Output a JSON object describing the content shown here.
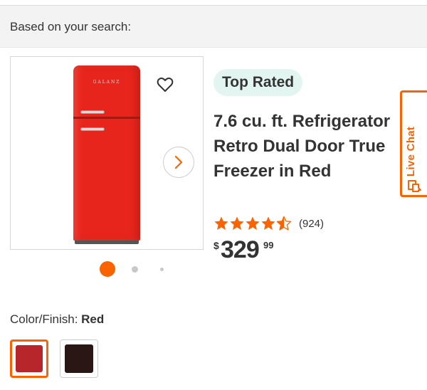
{
  "header": {
    "based_on": "Based on your search:"
  },
  "product": {
    "badge": "Top Rated",
    "title": "7.6 cu. ft. Refrigerator Retro Dual Door True Freezer in Red",
    "image_brand": "GALANZ",
    "rating": 4.5,
    "review_count": "(924)",
    "price": {
      "currency": "$",
      "whole": "329",
      "cents": "99"
    },
    "carousel": {
      "current": 1,
      "total": 3
    }
  },
  "live_chat": {
    "label": "Live Chat"
  },
  "color": {
    "label": "Color/Finish:",
    "selected": "Red",
    "options": [
      {
        "name": "Red",
        "hex": "#b7262a"
      },
      {
        "name": "Black",
        "hex": "#2a1614"
      }
    ]
  },
  "colors": {
    "accent": "#f96302",
    "badge_bg": "#e3f5f1",
    "star": "#f96302"
  },
  "icons": [
    "heart-icon",
    "chevron-right-icon",
    "star-icon",
    "chat-icon"
  ]
}
